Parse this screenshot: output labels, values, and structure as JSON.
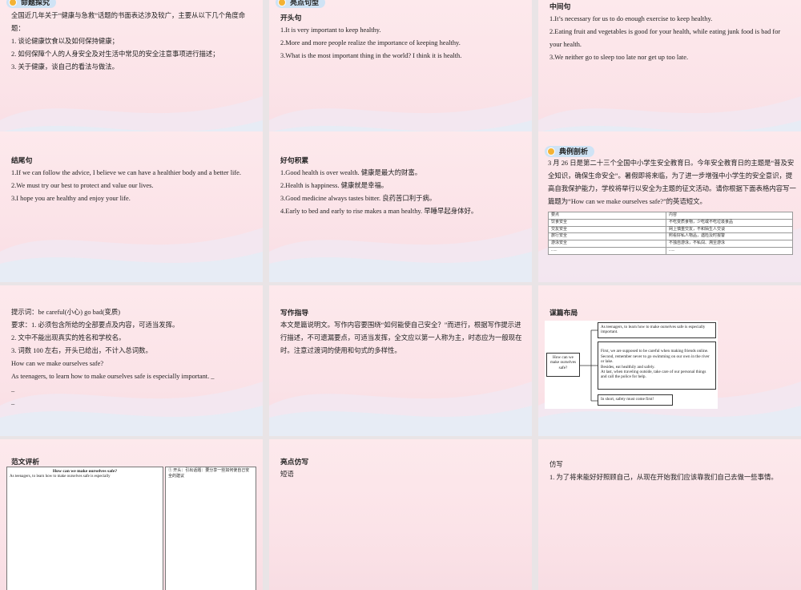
{
  "slide1": {
    "badge": "命题探究",
    "lines": [
      "全国近几年关于“健康与急救”话题的书面表达涉及较广，主要从以下几个角度命题：",
      "1. 谈论健康饮食以及如何保持健康；",
      "2. 如何保障个人的人身安全及对生活中常见的安全注意事项进行描述；",
      "3. 关于健康，谈自己的看法与做法。"
    ]
  },
  "slide2": {
    "badge": "亮点句型",
    "heading": "开头句",
    "lines": [
      "1.It is very important to keep healthy.",
      "2.More and more people realize the importance of keeping healthy.",
      "3.What is the most important thing in the world? I think it is health."
    ]
  },
  "slide3": {
    "heading": "中间句",
    "lines": [
      "1.It’s necessary for us to do enough exercise to keep healthy.",
      "2.Eating fruit and vegetables is good for your health, while eating junk food is bad for your health.",
      "3.We neither go to sleep too late nor get up too late."
    ]
  },
  "slide4": {
    "heading": "结尾句",
    "lines": [
      "1.If we can follow the advice, I believe we can have a healthier body and a better life.",
      "2.We must try our best to protect and value our lives.",
      "3.I hope you are healthy and enjoy your life."
    ]
  },
  "slide5": {
    "heading": "好句积累",
    "lines": [
      "1.Good health is over wealth. 健康是最大的财富。",
      "2.Health is happiness. 健康就是幸福。",
      "3.Good medicine always tastes bitter. 良药苦口利于病。",
      "4.Early to bed and early to rise makes a man healthy. 早睡早起身体好。"
    ]
  },
  "slide6": {
    "badge": "典例剖析",
    "lines": [
      "3 月 26 日是第二十三个全国中小学生安全教育日。今年安全教育日的主题是“普及安全知识，确保生命安全”。暑假即将来临，为了进一步增强中小学生的安全意识，提高自我保护能力，学校将举行以安全为主题的征文活动。请你根据下面表格内容写一篇题为“How can we make ourselves safe?”的英语短文。"
    ],
    "table": [
      [
        "要点",
        "内容"
      ],
      [
        "饮食安全",
        "不吃变质食物，少吃或不吃垃圾食品"
      ],
      [
        "交友安全",
        "网上慎重交友，不和陌生人交谈"
      ],
      [
        "旅行安全",
        "照看好私人物品，遇险及时报警"
      ],
      [
        "游泳安全",
        "不独自游泳，不私闯、溯至游泳"
      ],
      [
        "......",
        "......"
      ]
    ]
  },
  "slide7": {
    "lines": [
      "提示词：be careful(小心) go bad(变质)",
      "要求：1. 必须包含所给的全部要点及内容，可适当发挥。",
      "2. 文中不能出现真实的姓名和学校名。",
      "3. 词数 100 左右，开头已给出，不计入总词数。",
      "How can we make ourselves safe?",
      "As teenagers, to learn how to make ourselves safe is especially important. _",
      "_",
      "_"
    ]
  },
  "slide8": {
    "heading": "写作指导",
    "lines": [
      "本文是篇说明文。写作内容要围绕“如何能使自己安全？”而进行，根据写作提示进行描述，不可遗漏要点，可适当发挥，全文应以第一人称为主，时态应为一般现在时。注意过渡词的使用和句式的多样性。"
    ]
  },
  "slide9": {
    "heading": "谋篇布局",
    "center": "How can we make ourselves safe?",
    "boxes": [
      "As teenagers, to learn how to make ourselves safe is especially important.",
      "First, we are supposed to be careful when making friends online.\nSecond, remember never to go swimming on our own in the river or lake.\nBesides, eat healthily and safely.\nAt last, when traveling outside, take care of our personal things and call the police for help.",
      "In short, safety must come first!"
    ]
  },
  "slide10": {
    "heading": "范文评析",
    "essay_title": "How can we make ourselves safe?",
    "essay_line": "As teenagers, to learn how to make ourselves safe is especially",
    "note": "① 开头：引出话题：要分享一些如何使自己安全的建议"
  },
  "slide11": {
    "heading": "亮点仿写",
    "sub": "短语"
  },
  "slide12": {
    "heading": "仿写",
    "line": "1. 为了将来能好好照顾自己，从现在开始我们应该靠我们自己去做一些事情。"
  }
}
